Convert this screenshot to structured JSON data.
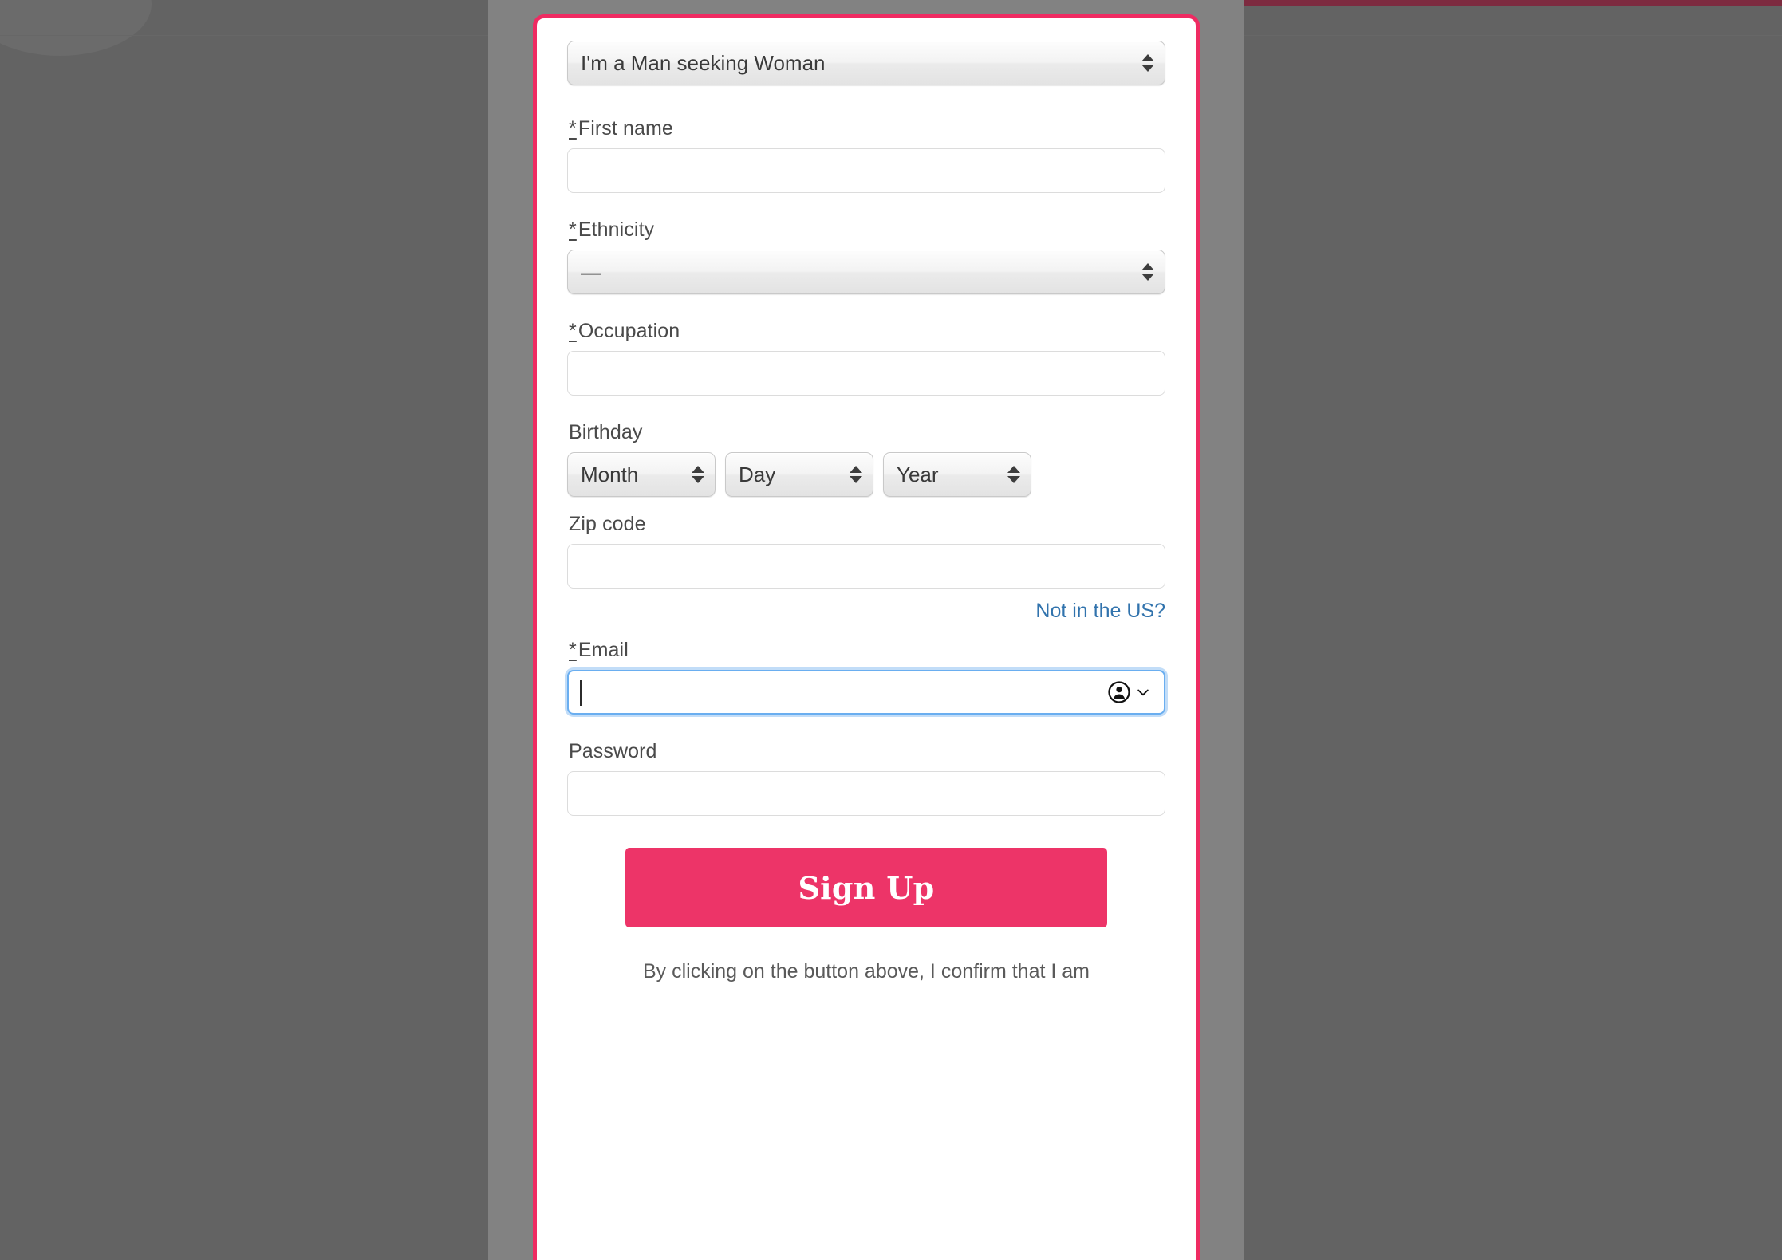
{
  "overlay": {
    "background_color": "#636363",
    "panel_color": "#828282",
    "top_bar_color": "#7d2b40"
  },
  "modal": {
    "border_color": "#ef2b62",
    "background_color": "#ffffff"
  },
  "form": {
    "seeking_select": {
      "value": "I'm a Man seeking Woman"
    },
    "first_name": {
      "required_mark": "*",
      "label": "First name",
      "value": ""
    },
    "ethnicity": {
      "required_mark": "*",
      "label": "Ethnicity",
      "value": "—"
    },
    "occupation": {
      "required_mark": "*",
      "label": "Occupation",
      "value": ""
    },
    "birthday": {
      "label": "Birthday",
      "month": "Month",
      "day": "Day",
      "year": "Year"
    },
    "zip_code": {
      "label": "Zip code",
      "value": ""
    },
    "not_in_us_link": "Not in the US?",
    "email": {
      "required_mark": "*",
      "label": "Email",
      "value": "",
      "focused": true,
      "autofill_icon": "person-circle-icon",
      "autofill_chevron": "chevron-down-icon"
    },
    "password": {
      "label": "Password",
      "value": ""
    },
    "submit_button": {
      "label": "Sign Up",
      "color": "#ed3468"
    },
    "terms_text": "By clicking on the button above, I confirm that I am"
  }
}
